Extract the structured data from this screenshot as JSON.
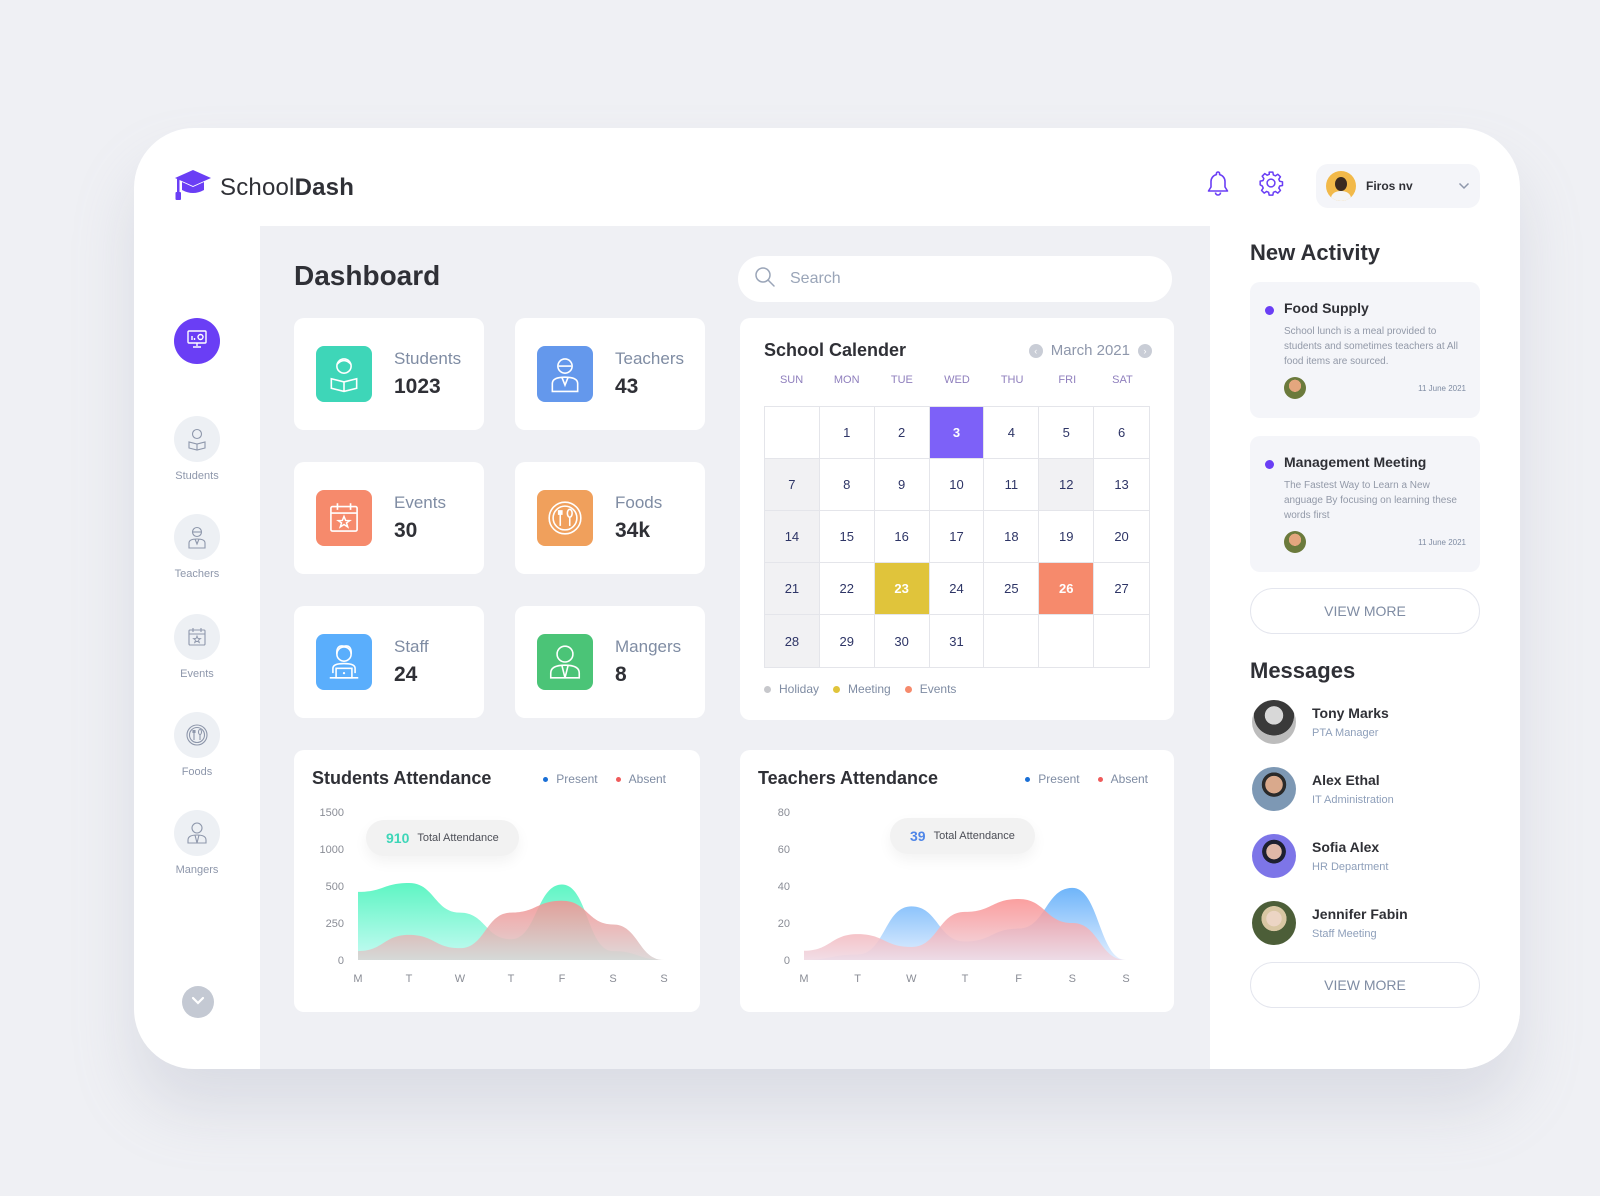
{
  "app": {
    "brand_light": "School",
    "brand_bold": "Dash",
    "accent_color": "#6a3ef5"
  },
  "header": {
    "user_name": "Firos nv",
    "icons": [
      "bell-icon",
      "gear-icon",
      "chevron-down-icon"
    ]
  },
  "sidebar": {
    "items": [
      {
        "label": "Students",
        "icon": "student-icon"
      },
      {
        "label": "Teachers",
        "icon": "teacher-icon"
      },
      {
        "label": "Events",
        "icon": "calendar-star-icon"
      },
      {
        "label": "Foods",
        "icon": "plate-cutlery-icon"
      },
      {
        "label": "Mangers",
        "icon": "manager-icon"
      }
    ]
  },
  "main": {
    "title": "Dashboard",
    "search_placeholder": "Search",
    "stats": [
      {
        "label": "Students",
        "value": "1023",
        "color": "#3ed6b8"
      },
      {
        "label": "Teachers",
        "value": "43",
        "color": "#6498ec"
      },
      {
        "label": "Events",
        "value": "30",
        "color": "#f68a6c"
      },
      {
        "label": "Foods",
        "value": "34k",
        "color": "#f0a05c"
      },
      {
        "label": "Staff",
        "value": "24",
        "color": "#5aaefc"
      },
      {
        "label": "Mangers",
        "value": "8",
        "color": "#4bc477"
      }
    ]
  },
  "calendar": {
    "title": "School Calender",
    "month": "March 2021",
    "days_of_week": [
      "SUN",
      "MON",
      "TUE",
      "WED",
      "THU",
      "FRI",
      "SAT"
    ],
    "cells": [
      "",
      "1",
      "2",
      "3",
      "4",
      "5",
      "6",
      "7",
      "8",
      "9",
      "10",
      "11",
      "12",
      "13",
      "14",
      "15",
      "16",
      "17",
      "18",
      "19",
      "20",
      "21",
      "22",
      "23",
      "24",
      "25",
      "26",
      "27",
      "28",
      "29",
      "30",
      "31",
      "",
      "",
      ""
    ],
    "holidays": [
      "7",
      "12",
      "14",
      "21",
      "28"
    ],
    "today": "3",
    "meetings": [
      "23"
    ],
    "events": [
      "26"
    ],
    "legend": [
      {
        "label": "Holiday",
        "color": "#c7c8cc"
      },
      {
        "label": "Meeting",
        "color": "#e0c43b"
      },
      {
        "label": "Events",
        "color": "#f68a6c"
      }
    ]
  },
  "chart_data": [
    {
      "type": "area",
      "title": "Students Attendance",
      "categories": [
        "M",
        "T",
        "W",
        "T",
        "F",
        "S",
        "S"
      ],
      "ylim": [
        0,
        1500
      ],
      "yticks": [
        "0",
        "250",
        "500",
        "1000",
        "1500"
      ],
      "series": [
        {
          "name": "Present",
          "legend_color": "#1a6fd6",
          "values": [
            460,
            540,
            320,
            140,
            520,
            60,
            0
          ]
        },
        {
          "name": "Absent",
          "legend_color": "#ef5b5b",
          "values": [
            60,
            170,
            80,
            320,
            400,
            240,
            0
          ]
        }
      ],
      "total_label": "Total Attendance",
      "total_value": "910",
      "total_color": "#3ed6b8"
    },
    {
      "type": "area",
      "title": "Teachers Attendance",
      "categories": [
        "M",
        "T",
        "W",
        "T",
        "F",
        "S",
        "S"
      ],
      "ylim": [
        0,
        80
      ],
      "yticks": [
        "0",
        "20",
        "40",
        "60",
        "80"
      ],
      "series": [
        {
          "name": "Present",
          "legend_color": "#1a6fd6",
          "values": [
            0,
            3,
            29,
            10,
            17,
            39,
            0
          ]
        },
        {
          "name": "Absent",
          "legend_color": "#ef5b5b",
          "values": [
            5,
            14,
            7,
            26,
            33,
            20,
            0
          ]
        }
      ],
      "total_label": "Total Attendance",
      "total_value": "39",
      "total_color": "#4f86e8"
    }
  ],
  "right": {
    "activity_title": "New Activity",
    "activities": [
      {
        "title": "Food Supply",
        "text": "School lunch is a meal provided to students and sometimes teachers at All food items are sourced.",
        "date": "11 June 2021"
      },
      {
        "title": "Management Meeting",
        "text": "The Fastest Way to Learn a New anguage By focusing on learning these words first",
        "date": "11 June 2021"
      }
    ],
    "view_more": "VIEW MORE",
    "messages_title": "Messages",
    "messages": [
      {
        "name": "Tony Marks",
        "role": "PTA Manager"
      },
      {
        "name": "Alex Ethal",
        "role": "IT Administration"
      },
      {
        "name": "Sofia Alex",
        "role": "HR Department"
      },
      {
        "name": "Jennifer Fabin",
        "role": "Staff Meeting"
      }
    ]
  }
}
